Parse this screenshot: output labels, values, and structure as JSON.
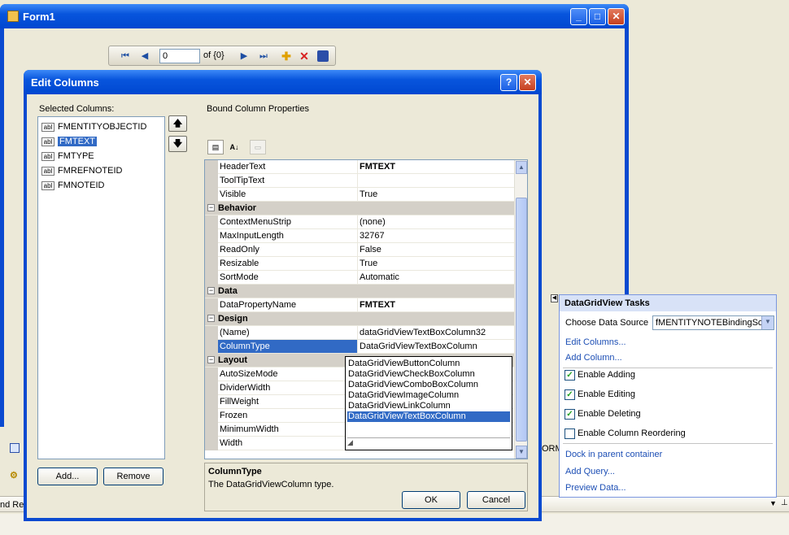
{
  "form1": {
    "title": "Form1"
  },
  "navigator": {
    "position": "0",
    "of_label": "of {0}"
  },
  "dialog": {
    "title": "Edit Columns",
    "selected_columns_label": "Selected Columns:",
    "columns": [
      "FMENTITYOBJECTID",
      "FMTEXT",
      "FMTYPE",
      "FMREFNOTEID",
      "FMNOTEID"
    ],
    "selected_index": 1,
    "column_icon_text": "abl",
    "add_label": "Add...",
    "remove_label": "Remove",
    "bound_props_label": "Bound Column Properties",
    "ok_label": "OK",
    "cancel_label": "Cancel",
    "help_glyph": "?",
    "close_glyph": "✕"
  },
  "properties": [
    {
      "type": "prop",
      "name": "HeaderText",
      "value": "FMTEXT",
      "bold": true
    },
    {
      "type": "prop",
      "name": "ToolTipText",
      "value": ""
    },
    {
      "type": "prop",
      "name": "Visible",
      "value": "True"
    },
    {
      "type": "cat",
      "name": "Behavior"
    },
    {
      "type": "prop",
      "name": "ContextMenuStrip",
      "value": "(none)"
    },
    {
      "type": "prop",
      "name": "MaxInputLength",
      "value": "32767"
    },
    {
      "type": "prop",
      "name": "ReadOnly",
      "value": "False"
    },
    {
      "type": "prop",
      "name": "Resizable",
      "value": "True"
    },
    {
      "type": "prop",
      "name": "SortMode",
      "value": "Automatic"
    },
    {
      "type": "cat",
      "name": "Data"
    },
    {
      "type": "prop",
      "name": "DataPropertyName",
      "value": "FMTEXT",
      "bold": true
    },
    {
      "type": "cat",
      "name": "Design"
    },
    {
      "type": "prop",
      "name": "(Name)",
      "value": "dataGridViewTextBoxColumn32"
    },
    {
      "type": "prop",
      "name": "ColumnType",
      "value": "DataGridViewTextBoxColumn",
      "selected": true
    },
    {
      "type": "cat",
      "name": "Layout"
    },
    {
      "type": "prop",
      "name": "AutoSizeMode",
      "value": ""
    },
    {
      "type": "prop",
      "name": "DividerWidth",
      "value": ""
    },
    {
      "type": "prop",
      "name": "FillWeight",
      "value": ""
    },
    {
      "type": "prop",
      "name": "Frozen",
      "value": ""
    },
    {
      "type": "prop",
      "name": "MinimumWidth",
      "value": ""
    },
    {
      "type": "prop",
      "name": "Width",
      "value": ""
    }
  ],
  "dropdown": {
    "options": [
      "DataGridViewButtonColumn",
      "DataGridViewCheckBoxColumn",
      "DataGridViewComboBoxColumn",
      "DataGridViewImageColumn",
      "DataGridViewLinkColumn",
      "DataGridViewTextBoxColumn"
    ],
    "selected_index": 5
  },
  "description": {
    "title": "ColumnType",
    "text": "The DataGridViewColumn type."
  },
  "tasks": {
    "title": "DataGridView Tasks",
    "choose_ds_label": "Choose Data Source",
    "data_source": "fMENTITYNOTEBindingSo",
    "edit_columns": "Edit Columns...",
    "add_column": "Add Column...",
    "checks": [
      {
        "label": "Enable Adding",
        "checked": true
      },
      {
        "label": "Enable Editing",
        "checked": true
      },
      {
        "label": "Enable Deleting",
        "checked": true
      },
      {
        "label": "Enable Column Reordering",
        "checked": false
      }
    ],
    "dock": "Dock in parent container",
    "add_query": "Add Query...",
    "preview": "Preview Data..."
  },
  "background": {
    "orm_fragment": "ORM",
    "res_fragment": "nd Res"
  }
}
